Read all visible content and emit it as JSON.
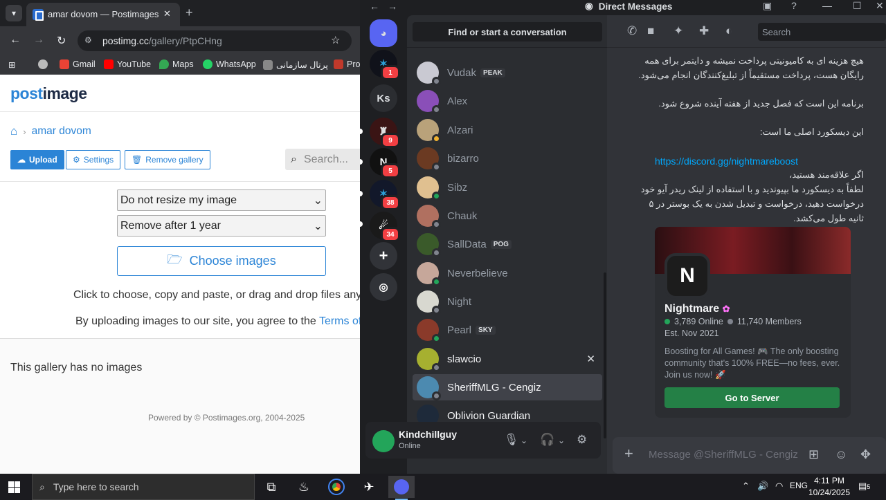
{
  "browser": {
    "tab_title": "amar dovom — Postimages",
    "url_domain": "postimg.cc",
    "url_path": "/gallery/PtpCHng",
    "bookmarks": [
      "Gmail",
      "YouTube",
      "Maps",
      "WhatsApp",
      "پرتال سازمانی",
      "Pro"
    ]
  },
  "postimage": {
    "logo_a": "post",
    "logo_b": "image",
    "breadcrumb": "amar dovom",
    "buttons": {
      "upload": "Upload",
      "settings": "Settings",
      "remove_gallery": "Remove gallery"
    },
    "search_placeholder": "Search...",
    "resize_select": "Do not resize my image",
    "expire_select": "Remove after 1 year",
    "choose_images": "Choose images",
    "hint": "Click to choose, copy and paste, or drag and drop files anywhere",
    "terms_prefix": "By uploading images to our site, you agree to the ",
    "terms_link": "Terms of Use",
    "empty": "This gallery has no images",
    "footer": "Powered by © Postimages.org, 2004-2025"
  },
  "discord": {
    "title": "Direct Messages",
    "server_initials": "Ks",
    "badges": [
      "1",
      "9",
      "5",
      "38",
      "34"
    ],
    "find_placeholder": "Find or start a conversation",
    "dms": [
      {
        "name": "Vudak",
        "tag": "PEAK",
        "status": "off",
        "color": "#c9c9d2"
      },
      {
        "name": "Alex",
        "tag": "",
        "status": "off",
        "color": "#8a4fb8"
      },
      {
        "name": "Alzari",
        "tag": "",
        "status": "idle",
        "color": "#b9a27a"
      },
      {
        "name": "bizarro",
        "tag": "",
        "status": "off",
        "color": "#6b3a22"
      },
      {
        "name": "Sibz",
        "tag": "",
        "status": "on",
        "color": "#e0c090"
      },
      {
        "name": "Chauk",
        "tag": "",
        "status": "off",
        "color": "#b07060"
      },
      {
        "name": "SallData",
        "tag": "POG",
        "status": "off",
        "color": "#3a5a2a"
      },
      {
        "name": "Neverbelieve",
        "tag": "",
        "status": "on",
        "color": "#c6a79a"
      },
      {
        "name": "Night",
        "tag": "",
        "status": "off",
        "color": "#d8d8d0"
      },
      {
        "name": "Pearl",
        "tag": "SKY",
        "status": "on",
        "color": "#8a3a2a"
      },
      {
        "name": "slawcio",
        "tag": "",
        "status": "off",
        "color": "#a6b030"
      },
      {
        "name": "SheriffMLG - Cengiz",
        "tag": "",
        "status": "off",
        "color": "#4c8ab0"
      },
      {
        "name": "Oblivion Guardian",
        "tag": "",
        "status": "",
        "color": "#1e2a3a"
      }
    ],
    "user": {
      "name": "Kindchillguy",
      "status": "Online"
    },
    "header_search": "Search",
    "messages": [
      "هیچ هزینه ای به کامیونیتی پرداخت نمیشه و دایتمر برای همه",
      "رایگان هست، پرداخت مستقیماً از تبلیغ‌کنندگان انجام می‌شود.",
      "برنامه این است که فصل جدید از هفته آینده شروع شود.",
      "این دیسکورد اصلی ما است:",
      "اگر علاقه‌مند هستید،",
      "لطفاً به دیسکورد ما بپیوندید و با استفاده از لینک ریدر آیو خود",
      "درخواست دهید، درخواست و تبدیل شدن به یک بوستر در ۵",
      "ثانیه طول می‌کشد."
    ],
    "invite_link": "https://discord.gg/nightmareboost",
    "embed": {
      "name": "Nightmare",
      "online": "3,789 Online",
      "members": "11,740 Members",
      "est": "Est. Nov 2021",
      "desc": "Boosting for All Games! 🎮 The only boosting community that's 100% FREE—no fees, ever. Join us now! 🚀",
      "button": "Go to Server"
    },
    "message_placeholder": "Message @SheriffMLG - Cengiz"
  },
  "taskbar": {
    "search_placeholder": "Type here to search",
    "lang": "ENG",
    "time": "4:11 PM",
    "date": "10/24/2025",
    "notif_count": "5"
  },
  "colors": {
    "discord_green": "#23a55a",
    "postimage_blue": "#2b84d6",
    "link_blue": "#00a8fc"
  }
}
